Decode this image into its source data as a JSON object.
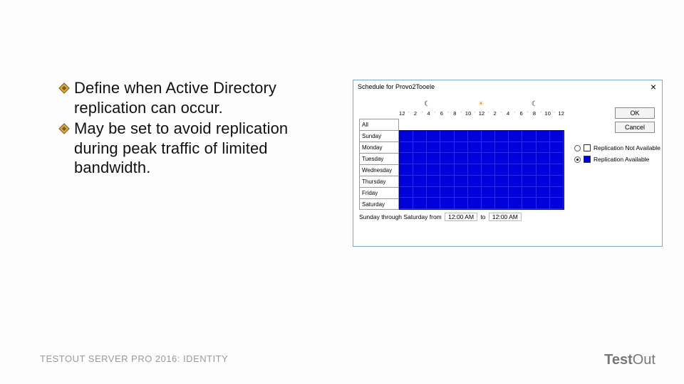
{
  "bullets": [
    "Define when Active Directory replication can occur.",
    "May be set to avoid replication during peak traffic of limited bandwidth."
  ],
  "footer": {
    "left": "TESTOUT SERVER PRO 2016: IDENTITY",
    "brand_bold": "Test",
    "brand_thin": "Out"
  },
  "dialog": {
    "title": "Schedule for Provo2Tooele",
    "close": "×",
    "ok": "OK",
    "cancel": "Cancel",
    "legend": {
      "not_available": "Replication Not Available",
      "available": "Replication Available"
    },
    "hours": [
      "12",
      "2",
      "4",
      "6",
      "8",
      "10",
      "12",
      "2",
      "4",
      "6",
      "8",
      "10",
      "12"
    ],
    "days": [
      "All",
      "Sunday",
      "Monday",
      "Tuesday",
      "Wednesday",
      "Thursday",
      "Friday",
      "Saturday"
    ],
    "status": {
      "range": "Sunday through Saturday from",
      "from": "12:00 AM",
      "to_word": "to",
      "to": "12:00 AM"
    },
    "icons": {
      "moon1": "☾",
      "sun": "☀",
      "moon2": "☾"
    }
  }
}
